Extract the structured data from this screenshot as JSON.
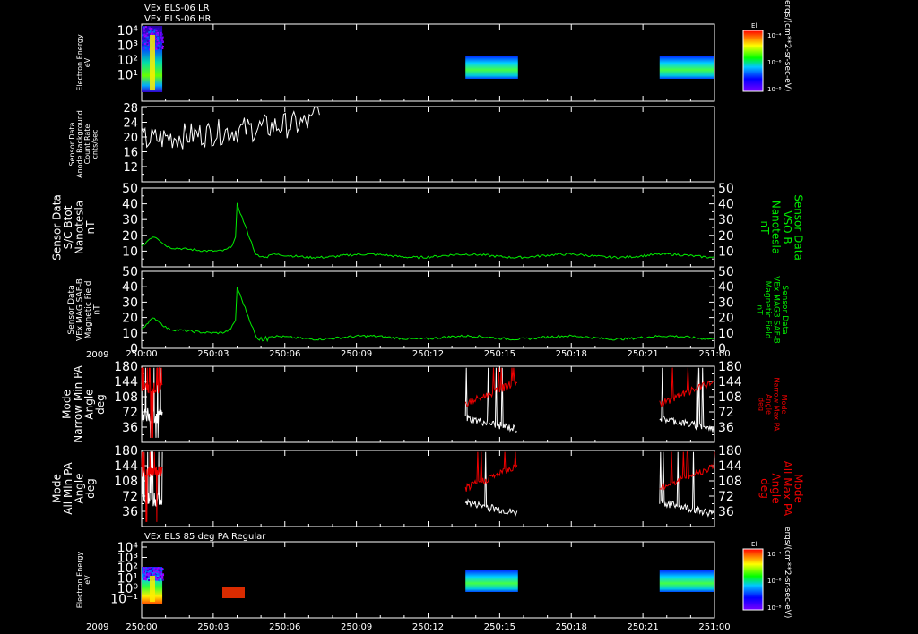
{
  "header": {
    "line1": "VEx ELS-06 LR",
    "line2": "VEx ELS-06 HR",
    "bottom_title": "VEx ELS 85 deg PA Regular"
  },
  "time_axis": {
    "year": "2009",
    "ticks": [
      "250:00",
      "250:03",
      "250:06",
      "250:09",
      "250:12",
      "250:15",
      "250:18",
      "250:21",
      "251:00"
    ]
  },
  "colors": {
    "background": "#000000",
    "white": "#ffffff",
    "green": "#00ee00",
    "red": "#ee0000"
  },
  "colorbar": {
    "title": "El",
    "ticks": [
      "10⁻⁴",
      "10⁻⁶",
      "10⁻⁸"
    ],
    "unit": "ergs/(cm**2-sr-sec-eV)"
  },
  "chart_data": [
    {
      "type": "heatmap",
      "name": "electron-energy-top",
      "ylabel": [
        "Electron Energy",
        "eV"
      ],
      "yscale": "log",
      "yticks": [
        "10⁴",
        "10³",
        "10²",
        "10¹"
      ],
      "segments": [
        {
          "start_min": 0,
          "end_min": 52,
          "energy_range": [
            1,
            20000
          ]
        },
        {
          "start_min": 814,
          "end_min": 946,
          "energy_range": [
            10,
            200
          ]
        },
        {
          "start_min": 1302,
          "end_min": 1440,
          "energy_range": [
            10,
            200
          ]
        }
      ]
    },
    {
      "type": "line",
      "name": "anode-background",
      "ylabel": [
        "Sensor Data",
        "Anode Background",
        "Count Rate",
        "cnts/sec"
      ],
      "ylim": [
        10,
        28
      ],
      "yticks": [
        "28",
        "24",
        "20",
        "16",
        "12"
      ],
      "series": [
        {
          "color": "#ffffff",
          "x_range_min": [
            0,
            52
          ]
        }
      ]
    },
    {
      "type": "line",
      "name": "sc-btot",
      "ylabel": [
        "Sensor Data",
        "S/C Btot",
        "Nanotesla",
        "nT"
      ],
      "ylabel_right": [
        "Sensor Data",
        "VSO B",
        "Nanotesla",
        "nT"
      ],
      "ylim": [
        0,
        50
      ],
      "yticks": [
        "50",
        "40",
        "30",
        "20",
        "10"
      ],
      "series": [
        {
          "color": "#00ee00",
          "peak": {
            "x_min": 27,
            "y": 40
          },
          "baseline": 7
        }
      ]
    },
    {
      "type": "line",
      "name": "mag-saf-b",
      "ylabel": [
        "Sensor Data",
        "VEx MAG SAF-B",
        "Magnetic Field",
        "nT"
      ],
      "ylabel_right": [
        "Sensor Data",
        "VEx MAG3 SAF-B",
        "Magnetic Field",
        "nT"
      ],
      "ylim": [
        0,
        50
      ],
      "yticks": [
        "50",
        "40",
        "30",
        "20",
        "10",
        "0"
      ],
      "series": [
        {
          "color": "#00ee00",
          "peak": {
            "x_min": 27,
            "y": 40
          },
          "baseline": 6
        }
      ]
    },
    {
      "type": "line",
      "name": "narrow-pa",
      "ylabel": [
        "Mode",
        "Narrow Min PA",
        "Angle",
        "deg"
      ],
      "ylabel_right": [
        "Mode",
        "Narrow Max PA",
        "Angle",
        "deg"
      ],
      "ylim": [
        0,
        180
      ],
      "yticks": [
        "180",
        "144",
        "108",
        "72",
        "36"
      ],
      "series": [
        {
          "color": "#ffffff",
          "segments_min": [
            [
              0,
              52
            ],
            [
              814,
              946
            ],
            [
              1302,
              1440
            ]
          ]
        },
        {
          "color": "#ee0000",
          "segments_min": [
            [
              0,
              52
            ],
            [
              814,
              946
            ],
            [
              1302,
              1440
            ]
          ]
        }
      ]
    },
    {
      "type": "line",
      "name": "all-pa",
      "ylabel": [
        "Mode",
        "All Min PA",
        "Angle",
        "deg"
      ],
      "ylabel_right": [
        "Mode",
        "All Max PA",
        "Angle",
        "deg"
      ],
      "ylim": [
        0,
        180
      ],
      "yticks": [
        "180",
        "144",
        "108",
        "72",
        "36"
      ],
      "series": [
        {
          "color": "#ffffff",
          "segments_min": [
            [
              0,
              52
            ],
            [
              814,
              946
            ],
            [
              1302,
              1440
            ]
          ]
        },
        {
          "color": "#ee0000",
          "segments_min": [
            [
              0,
              52
            ],
            [
              814,
              946
            ],
            [
              1302,
              1440
            ]
          ]
        }
      ]
    },
    {
      "type": "heatmap",
      "name": "electron-energy-85deg",
      "ylabel": [
        "Electron Energy",
        "eV"
      ],
      "yscale": "log",
      "yticks": [
        "10⁴",
        "10³",
        "10²",
        "10¹",
        "10⁰",
        "10⁻¹"
      ],
      "segments": [
        {
          "start_min": 0,
          "end_min": 52,
          "energy_range": [
            0.3,
            300
          ]
        },
        {
          "start_min": 814,
          "end_min": 946,
          "energy_range": [
            1,
            100
          ]
        },
        {
          "start_min": 1302,
          "end_min": 1440,
          "energy_range": [
            1,
            100
          ]
        }
      ]
    }
  ]
}
